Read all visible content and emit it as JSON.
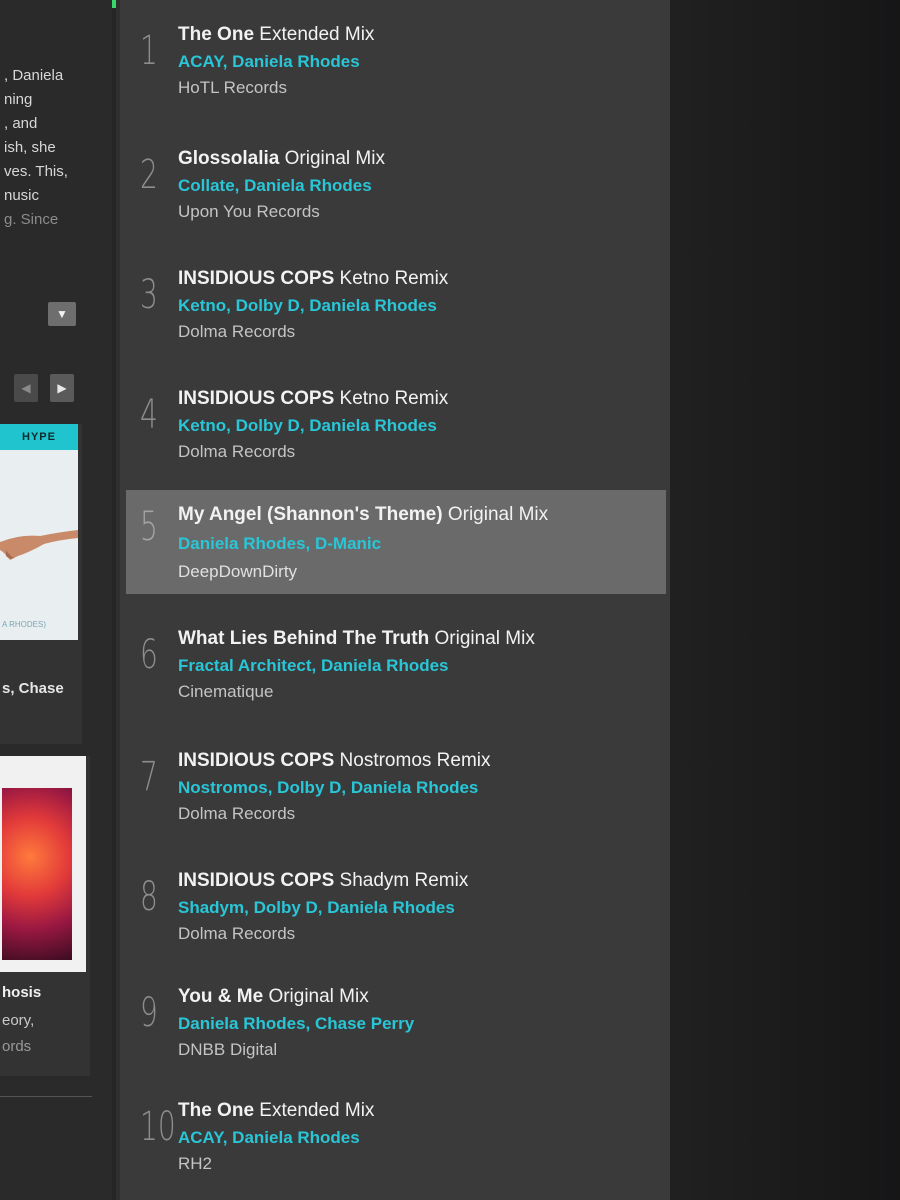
{
  "left": {
    "bio_lines": [
      ", Daniela",
      "ning",
      ", and",
      "ish, she",
      "ves. This,",
      "nusic",
      "g. Since"
    ],
    "hype_label": "HYPE",
    "card1_caption": "A RHODES)",
    "card1_text": "s, Chase",
    "card2_title": "hosis",
    "card2_line2": "eory,",
    "card2_line3": "ords"
  },
  "tracks": [
    {
      "num": "1",
      "title": "The One",
      "mix": "Extended Mix",
      "artists": "ACAY, Daniela Rhodes",
      "label": "HoTL Records"
    },
    {
      "num": "2",
      "title": "Glossolalia",
      "mix": "Original Mix",
      "artists": "Collate, Daniela Rhodes",
      "label": "Upon You Records"
    },
    {
      "num": "3",
      "title": "INSIDIOUS COPS",
      "mix": "Ketno Remix",
      "artists": "Ketno, Dolby D, Daniela Rhodes",
      "label": "Dolma Records"
    },
    {
      "num": "4",
      "title": "INSIDIOUS COPS",
      "mix": "Ketno Remix",
      "artists": "Ketno, Dolby D, Daniela Rhodes",
      "label": "Dolma Records"
    },
    {
      "num": "5",
      "title": "My Angel (Shannon's Theme)",
      "mix": "Original Mix",
      "artists": "Daniela Rhodes, D-Manic",
      "label": "DeepDownDirty"
    },
    {
      "num": "6",
      "title": "What Lies Behind The Truth",
      "mix": "Original Mix",
      "artists": "Fractal Architect, Daniela Rhodes",
      "label": "Cinematique"
    },
    {
      "num": "7",
      "title": "INSIDIOUS COPS",
      "mix": "Nostromos Remix",
      "artists": "Nostromos, Dolby D, Daniela Rhodes",
      "label": "Dolma Records"
    },
    {
      "num": "8",
      "title": "INSIDIOUS COPS",
      "mix": "Shadym Remix",
      "artists": "Shadym, Dolby D, Daniela Rhodes",
      "label": "Dolma Records"
    },
    {
      "num": "9",
      "title": "You & Me",
      "mix": "Original Mix",
      "artists": "Daniela Rhodes, Chase Perry",
      "label": "DNBB Digital"
    },
    {
      "num": "10",
      "title": "The One",
      "mix": "Extended Mix",
      "artists": "ACAY, Daniela Rhodes",
      "label": "RH2"
    }
  ],
  "colors": {
    "accent": "#28c6d6",
    "hype": "#20c4cf",
    "selected_row": "#6a6a6b"
  },
  "icons": {
    "dropdown": "chevron-down-icon",
    "prev": "chevron-left-icon",
    "next": "chevron-right-icon"
  }
}
